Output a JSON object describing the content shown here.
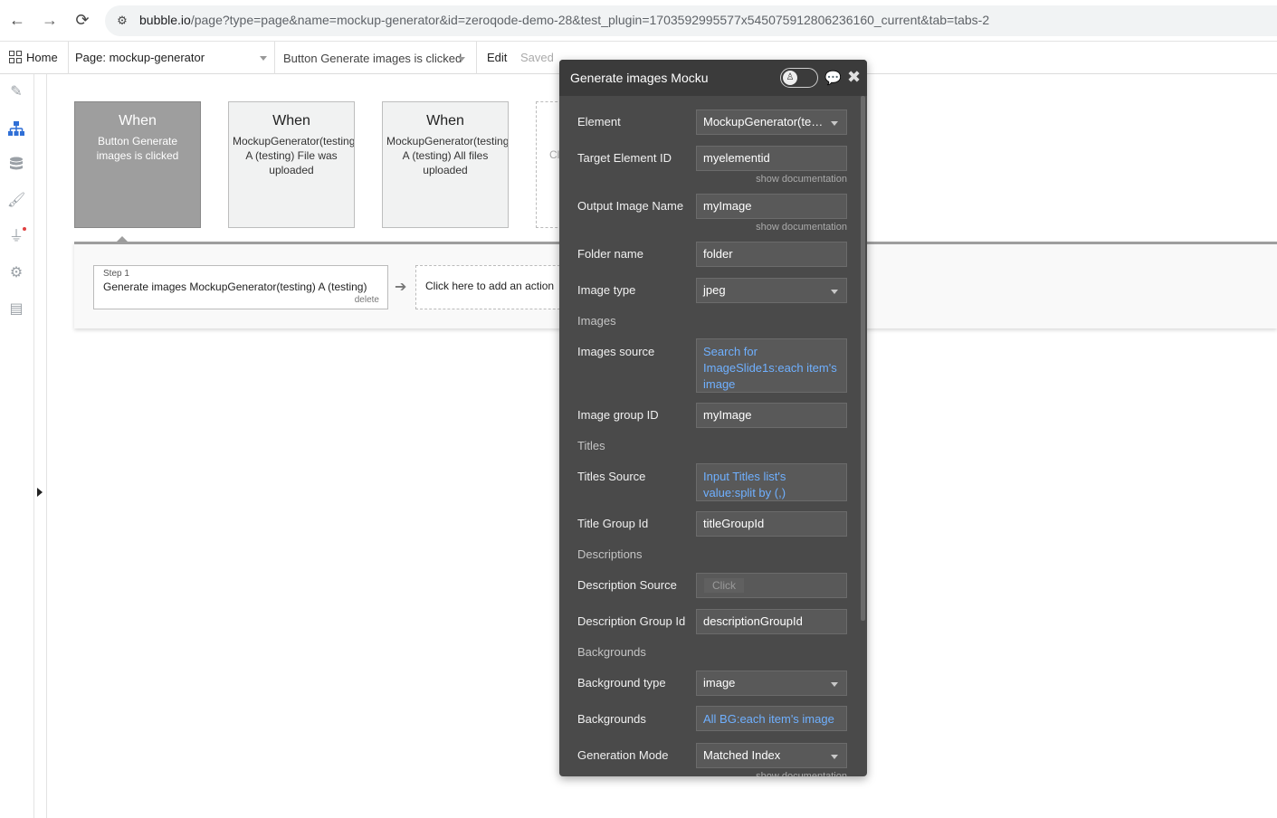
{
  "browser": {
    "back": "←",
    "forward": "→",
    "reload": "⟳",
    "site_icon": "⚙",
    "url_host": "bubble.io",
    "url_path": "/page?type=page&name=mockup-generator&id=zeroqode-demo-28&test_plugin=1703592995577x545075912806236160_current&tab=tabs-2"
  },
  "toolbar": {
    "home_label": "Home",
    "page_select": "Page: mockup-generator",
    "event_select": "Button Generate images is clicked",
    "edit_label": "Edit",
    "saved_label": "Saved"
  },
  "left_rail": {
    "icons": [
      "design-icon",
      "workflow-icon",
      "data-icon",
      "styles-icon",
      "plugins-icon",
      "settings-icon",
      "logs-icon"
    ]
  },
  "events": [
    {
      "when": "When",
      "desc": "Button Generate images is clicked"
    },
    {
      "when": "When",
      "desc": "MockupGenerator(testing) A (testing) File was uploaded"
    },
    {
      "when": "When",
      "desc": "MockupGenerator(testing) A (testing) All files uploaded"
    },
    {
      "desc": "Cl"
    }
  ],
  "actions": {
    "step_num": "Step 1",
    "step_title": "Generate images MockupGenerator(testing) A (testing)",
    "step_delete": "delete",
    "arrow": "➔",
    "add_action": "Click here to add an action"
  },
  "editor": {
    "title": "Generate images Mocku",
    "toggle_glyph": "♙",
    "comment_glyph": "💬",
    "close_glyph": "✖",
    "fields": {
      "element_label": "Element",
      "element_value": "MockupGenerator(testing) A (testing)",
      "target_label": "Target Element ID",
      "target_value": "myelementid",
      "output_label": "Output Image Name",
      "output_value": "myImage",
      "show_doc": "show documentation",
      "folder_label": "Folder name",
      "folder_value": "folder",
      "image_type_label": "Image type",
      "image_type_value": "jpeg",
      "images_section": "Images",
      "images_source_label": "Images source",
      "images_source_value": "Search for ImageSlide1s:each item's image",
      "image_group_label": "Image group ID",
      "image_group_value": "myImage",
      "titles_section": "Titles",
      "titles_source_label": "Titles Source",
      "titles_source_value": "Input Titles list's value:split by (,)",
      "title_group_label": "Title Group Id",
      "title_group_value": "titleGroupId",
      "descriptions_section": "Descriptions",
      "description_source_label": "Description Source",
      "description_source_placeholder": "Click",
      "description_group_label": "Description Group Id",
      "description_group_value": "descriptionGroupId",
      "backgrounds_section": "Backgrounds",
      "background_type_label": "Background type",
      "background_type_value": "image",
      "backgrounds_label": "Backgrounds",
      "backgrounds_value": "All BG:each item's image",
      "generation_mode_label": "Generation Mode",
      "generation_mode_value": "Matched Index"
    }
  },
  "colors": {
    "editor_bg": "#4a4a4a",
    "dynamic_text": "#6fb0ff",
    "selected_event": "#9e9e9e"
  }
}
